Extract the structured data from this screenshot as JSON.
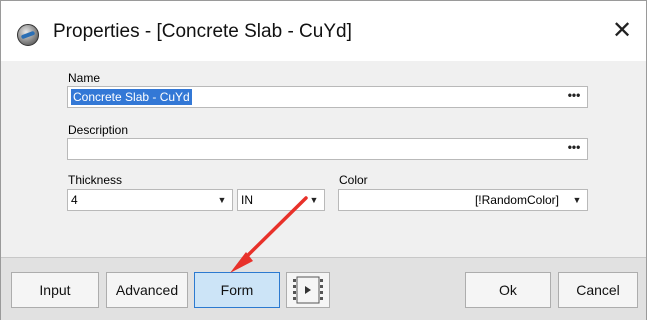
{
  "window": {
    "title": "Properties - [Concrete Slab - CuYd]",
    "close_glyph": "✕",
    "app_icon": "concrete-app-icon"
  },
  "form": {
    "name_label": "Name",
    "name_value": "Concrete Slab - CuYd",
    "description_label": "Description",
    "description_value": "",
    "ellipsis_label": "•••",
    "thickness_label": "Thickness",
    "thickness_value": "4",
    "unit_value": "IN",
    "color_label": "Color",
    "color_value": "[!RandomColor]",
    "dropdown_glyph": "▼"
  },
  "buttons": {
    "input": "Input",
    "advanced": "Advanced",
    "form": "Form",
    "ok": "Ok",
    "cancel": "Cancel"
  },
  "colors": {
    "annotation_arrow": "#e8312a",
    "active_button": "#cce4f7",
    "selection": "#3378d6"
  }
}
